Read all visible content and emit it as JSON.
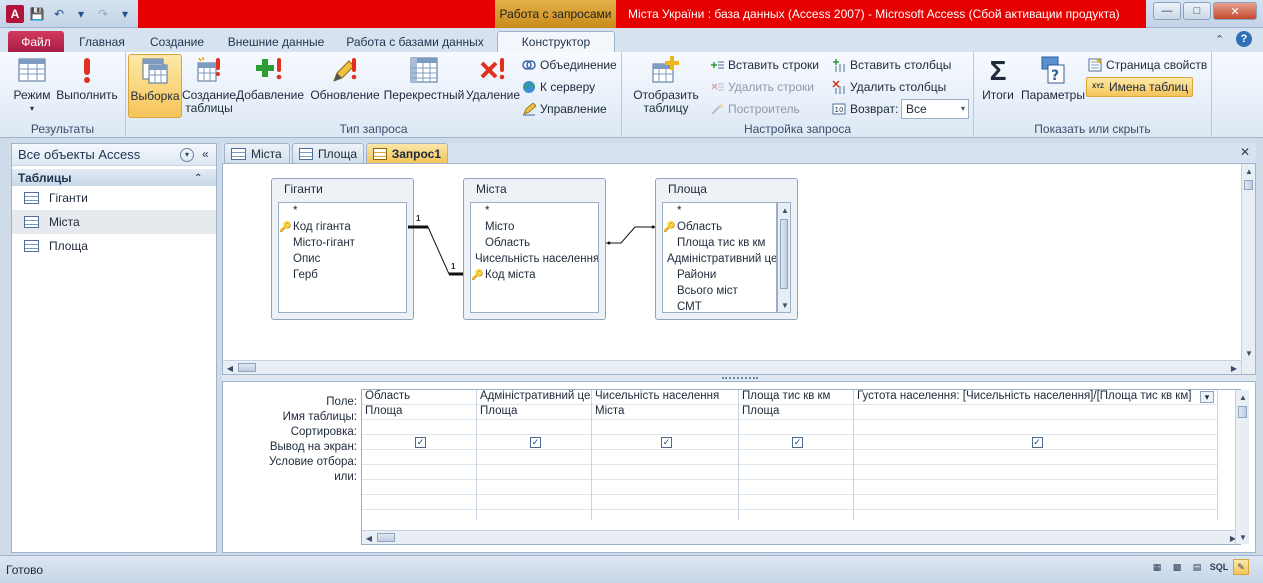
{
  "title": {
    "context_tab": "Работа с запросами",
    "window_title": "Міста України : база данных (Access 2007)  -  Microsoft Access (Сбой активации продукта)"
  },
  "ribbon_tabs": [
    "Файл",
    "Главная",
    "Создание",
    "Внешние данные",
    "Работа с базами данных",
    "Конструктор"
  ],
  "groups": {
    "results": {
      "label": "Результаты",
      "mode": "Режим",
      "run": "Выполнить"
    },
    "query_type": {
      "label": "Тип запроса",
      "select": "Выборка",
      "make_table": "Создание таблицы",
      "append": "Добавление",
      "update": "Обновление",
      "crosstab": "Перекрестный",
      "delete": "Удаление",
      "union": "Объединение",
      "passthrough": "К серверу",
      "data_def": "Управление"
    },
    "query_setup": {
      "label": "Настройка запроса",
      "show_table": "Отобразить таблицу",
      "insert_rows": "Вставить строки",
      "delete_rows": "Удалить строки",
      "builder": "Построитель",
      "insert_cols": "Вставить столбцы",
      "delete_cols": "Удалить столбцы",
      "return_label": "Возврат:",
      "return_value": "Все"
    },
    "show_hide": {
      "label": "Показать или скрыть",
      "totals": "Итоги",
      "params": "Параметры",
      "property_sheet": "Страница свойств",
      "table_names": "Имена таблиц"
    }
  },
  "nav": {
    "header": "Все объекты Access",
    "group": "Таблицы",
    "items": [
      "Гіганти",
      "Міста",
      "Площа"
    ]
  },
  "doc_tabs": [
    "Міста",
    "Площа",
    "Запрос1"
  ],
  "tables": [
    {
      "name": "Гіганти",
      "fields": [
        {
          "n": "*",
          "k": false
        },
        {
          "n": "Код гіганта",
          "k": true
        },
        {
          "n": "Місто-гігант",
          "k": false
        },
        {
          "n": "Опис",
          "k": false
        },
        {
          "n": "Герб",
          "k": false
        }
      ]
    },
    {
      "name": "Міста",
      "fields": [
        {
          "n": "*",
          "k": false
        },
        {
          "n": "Місто",
          "k": false
        },
        {
          "n": "Область",
          "k": false
        },
        {
          "n": "Чисельність населення",
          "k": false
        },
        {
          "n": "Код міста",
          "k": true
        }
      ]
    },
    {
      "name": "Площа",
      "fields": [
        {
          "n": "*",
          "k": false
        },
        {
          "n": "Область",
          "k": true
        },
        {
          "n": "Площа тис кв км",
          "k": false
        },
        {
          "n": "Адміністративний центр",
          "k": false
        },
        {
          "n": "Райони",
          "k": false
        },
        {
          "n": "Всього міст",
          "k": false
        },
        {
          "n": "СМТ",
          "k": false
        }
      ]
    }
  ],
  "relations": {
    "one_left": "1",
    "one_right": "1"
  },
  "grid": {
    "row_labels": [
      "Поле:",
      "Имя таблицы:",
      "Сортировка:",
      "Вывод на экран:",
      "Условие отбора:",
      "или:"
    ],
    "columns": [
      {
        "field": "Область",
        "table": "Площа",
        "show": true
      },
      {
        "field": "Адміністративний центр",
        "table": "Площа",
        "show": true
      },
      {
        "field": "Чисельність населення",
        "table": "Міста",
        "show": true
      },
      {
        "field": "Площа тис кв км",
        "table": "Площа",
        "show": true
      },
      {
        "field": "Густота населення: [Чисельність населення]/[Площа тис кв км]",
        "table": "",
        "show": true
      }
    ]
  },
  "status": "Готово",
  "view_buttons": [
    "SQL"
  ]
}
